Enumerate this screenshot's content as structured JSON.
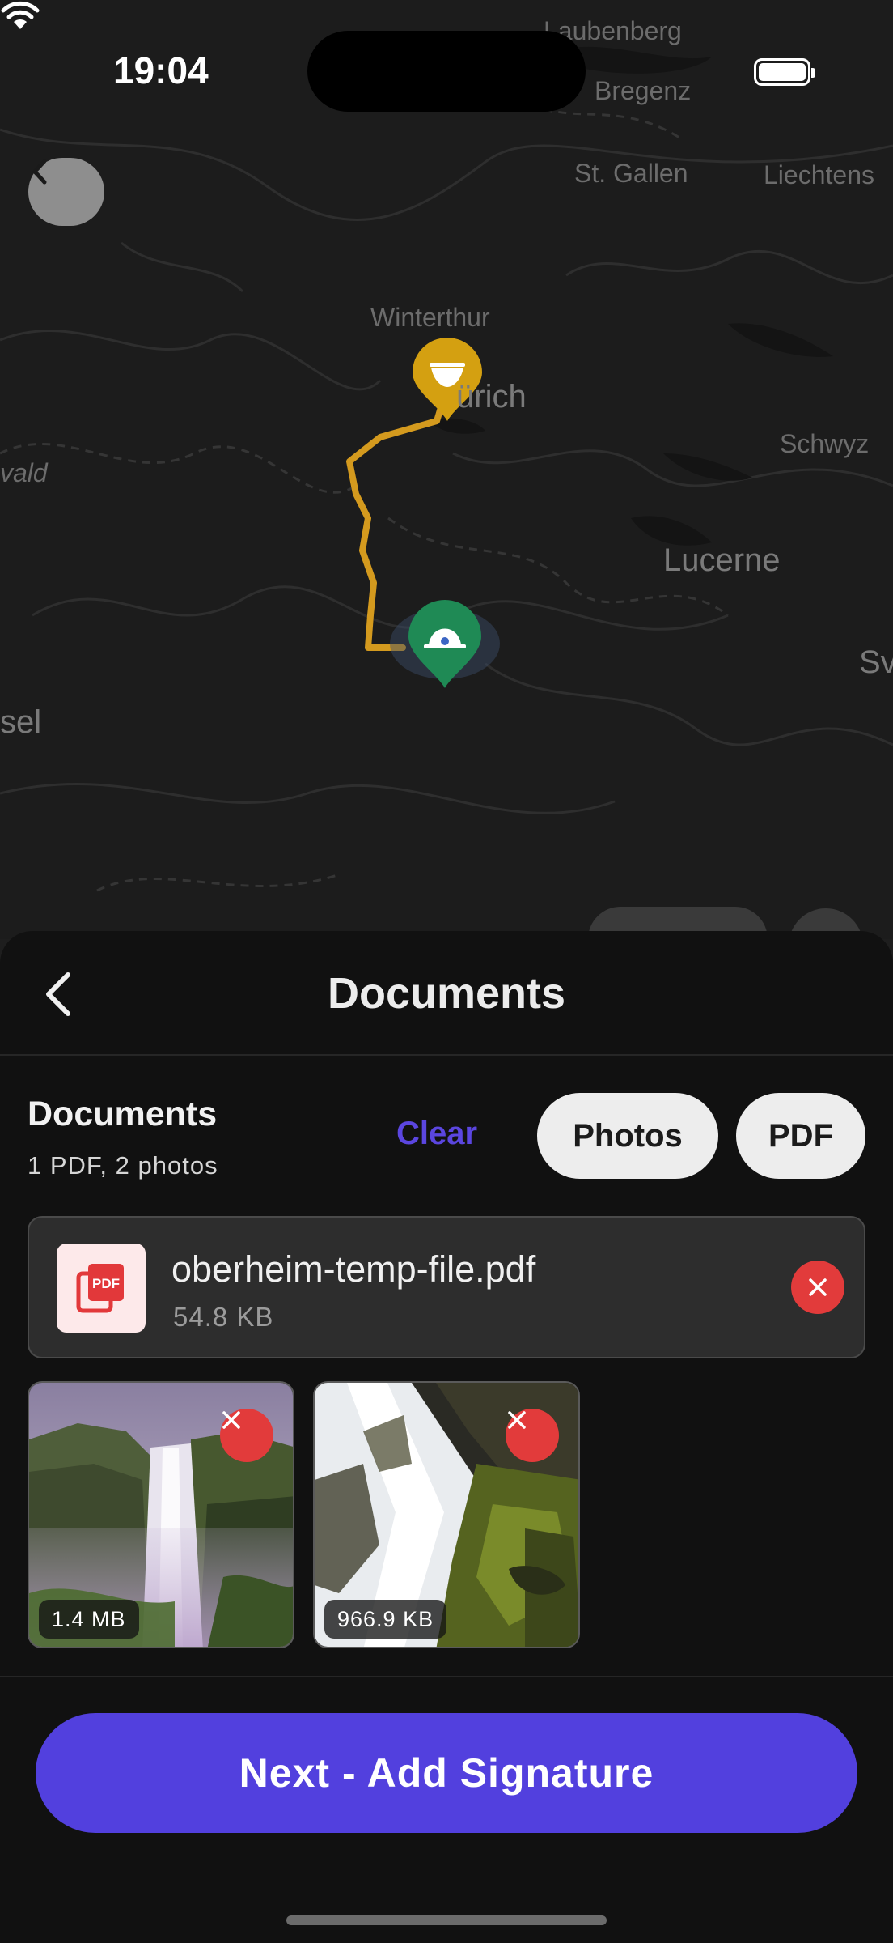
{
  "status_bar": {
    "time": "19:04"
  },
  "map": {
    "cities": {
      "laubenberg": "Laubenberg",
      "bregenz": "Bregenz",
      "st_gallen": "St. Gallen",
      "liechtenstein": "Liechtens",
      "winterthur": "Winterthur",
      "zurich": "ürich",
      "schwyz": "Schwyz",
      "lucerne": "Lucerne",
      "wald": "vald",
      "basel": "sel",
      "sv": "Sv"
    },
    "route_color": "#d49a1e",
    "start_pin_color": "#d4a011",
    "end_pin_color": "#1f8a55"
  },
  "sheet": {
    "title": "Documents",
    "section_title": "Documents",
    "section_subtitle": "1 PDF, 2 photos",
    "clear_label": "Clear",
    "photos_label": "Photos",
    "pdf_label": "PDF",
    "pdf_file": {
      "name": "oberheim-temp-file.pdf",
      "size": "54.8 KB",
      "icon": "pdf-icon"
    },
    "photos": [
      {
        "size": "1.4 MB",
        "subject": "waterfall-cliff"
      },
      {
        "size": "966.9 KB",
        "subject": "waterfall-rocks"
      }
    ],
    "next_label": "Next - Add Signature"
  },
  "colors": {
    "accent": "#5240de",
    "clear_text": "#5b46e0",
    "remove": "#e23b3b",
    "sheet_bg": "#111111"
  }
}
